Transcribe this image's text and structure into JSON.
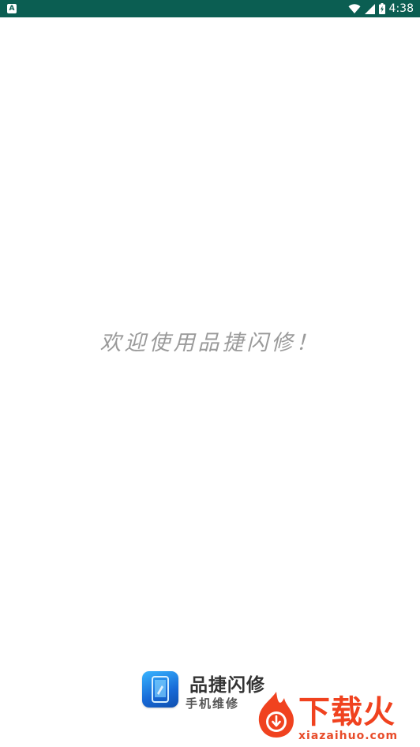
{
  "status_bar": {
    "left_badge": "A",
    "time": "4:38",
    "icons": [
      "wifi-icon",
      "cellular-signal-icon",
      "battery-charging-icon"
    ],
    "background": "#0b5e52"
  },
  "splash": {
    "welcome_text": "欢迎使用品捷闪修！"
  },
  "brand": {
    "app_name": "品捷闪修",
    "tagline": "手机维修",
    "icon": "phone-app-icon",
    "icon_color": "#1f7fe0"
  },
  "watermark": {
    "title": "下载火",
    "url": "xiazaihuo.com",
    "icon": "download-flame-icon",
    "color": "#f0421f"
  }
}
